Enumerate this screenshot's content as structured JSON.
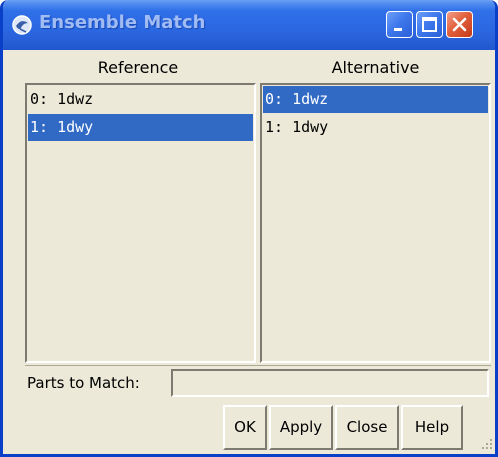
{
  "window": {
    "title": "Ensemble Match",
    "app_icon": "chimera-icon",
    "title_buttons": [
      "minimize-icon",
      "maximize-icon",
      "close-icon"
    ],
    "accent_color": "#2b69e3",
    "selection_color": "#316ac5"
  },
  "reference": {
    "header": "Reference",
    "items": [
      "0: 1dwz",
      "1: 1dwy"
    ],
    "selected": "1: 1dwy"
  },
  "alternative": {
    "header": "Alternative",
    "items": [
      "0: 1dwz",
      "1: 1dwy"
    ],
    "selected": "0: 1dwz"
  },
  "parts": {
    "label": "Parts to Match:",
    "value": ""
  },
  "buttons": {
    "ok": "OK",
    "apply": "Apply",
    "close": "Close",
    "help": "Help"
  }
}
